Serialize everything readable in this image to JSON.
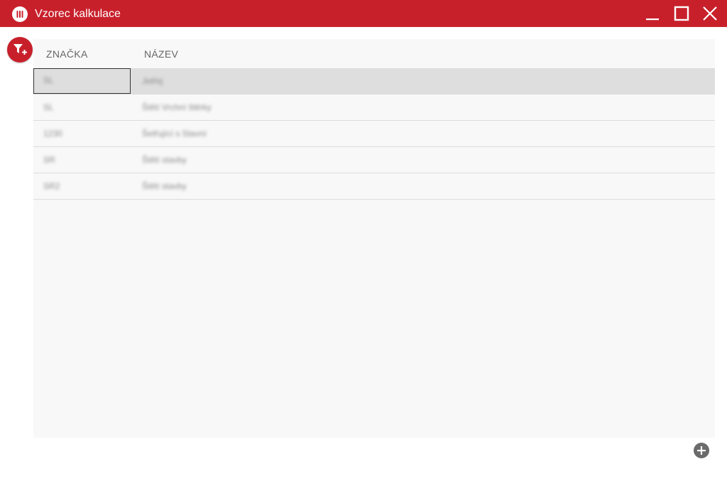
{
  "window": {
    "title": "Vzorec kalkulace"
  },
  "colors": {
    "brand": "#c8202b",
    "grid_bg": "#f8f8f8",
    "selected_row": "#dedede",
    "add_button": "#6b6b6b"
  },
  "icons": {
    "app": "app-logo-icon",
    "filter": "filter-add-icon",
    "add": "plus-circle-icon",
    "minimize": "minimize-icon",
    "maximize": "maximize-icon",
    "close": "close-icon"
  },
  "table": {
    "columns": [
      "ZNAČKA",
      "NÁZEV"
    ],
    "rows": [
      {
        "code": "SL",
        "name": "Jetřej"
      },
      {
        "code": "SL",
        "name": "Štětí Vrchní štěrky"
      },
      {
        "code": "1230",
        "name": "Šetřující s Stavní"
      },
      {
        "code": "SR",
        "name": "Štětí stavby"
      },
      {
        "code": "SR2",
        "name": "Štětí stavby"
      }
    ]
  }
}
